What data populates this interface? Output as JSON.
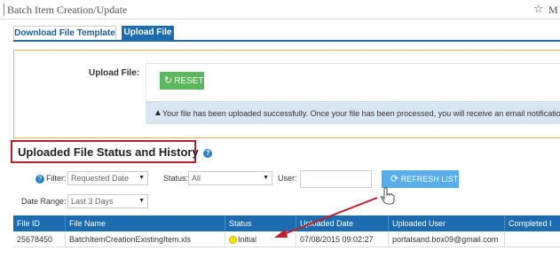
{
  "header": {
    "title": "Batch Item Creation/Update",
    "star_icon": "star-icon",
    "cut_text": "M"
  },
  "tabs": [
    {
      "label": "Download File Template",
      "active": false
    },
    {
      "label": "Upload File",
      "active": true
    }
  ],
  "upload": {
    "label": "Upload File:",
    "reset_label": "RESET",
    "alert_message": "Your file has been uploaded successfully. Once your file has been processed, you will receive an email notificatio"
  },
  "history": {
    "title": "Uploaded File Status and History",
    "filter_label": "Filter:",
    "filter_value": "Requested Date",
    "status_label": "Status:",
    "status_value": "All",
    "user_label": "User:",
    "user_value": "",
    "refresh_label": "REFRESH LIST",
    "date_range_label": "Date Range:",
    "date_range_value": "Last 3 Days"
  },
  "table": {
    "headers": [
      "File ID",
      "File Name",
      "Status",
      "Uploaded Date",
      "Uploaded User",
      "Completed I"
    ],
    "rows": [
      {
        "file_id": "25678450",
        "file_name": "BatchItemCreationExistingItem.xls",
        "status": "Initial",
        "uploaded_date": "07/08/2015 09:02:27",
        "uploaded_user": "portalsand.box09@gmail.com",
        "completed": ""
      }
    ]
  },
  "colors": {
    "tab_active": "#1b6cb0",
    "panel_border": "#f0b14a",
    "reset_button": "#5cb85c",
    "alert_bg": "#d8e6f3",
    "highlight_box": "#b7202e",
    "refresh_button": "#5aaee7",
    "status_initial": "#f2e500",
    "annotation_arrow": "#c0202e"
  }
}
